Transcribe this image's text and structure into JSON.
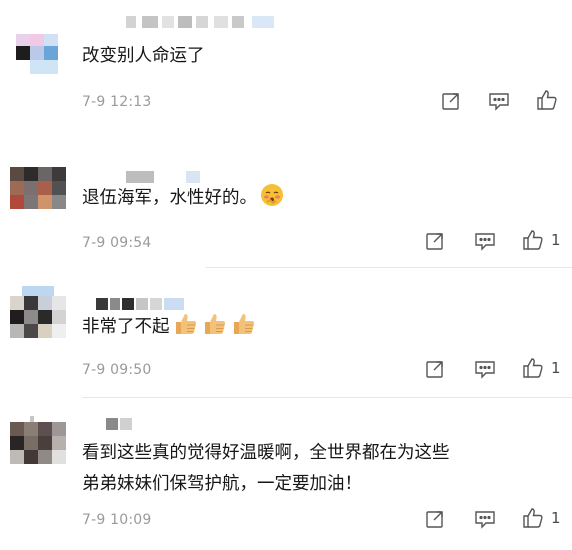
{
  "comments": [
    {
      "text": "改变别人命运了",
      "timestamp": "7-9 12:13",
      "likes": ""
    },
    {
      "text": "退伍海军，水性好的。",
      "timestamp": "7-9 09:54",
      "likes": "1"
    },
    {
      "text": "非常了不起",
      "timestamp": "7-9 09:50",
      "likes": "1"
    },
    {
      "text_line1": "看到这些真的觉得好温暖啊，全世界都在为这些",
      "text_line2": "弟弟妹妹们保驾护航，一定要加油！",
      "timestamp": "7-9 10:09",
      "likes": "1"
    }
  ],
  "icons": {
    "share": "share-icon",
    "comment": "comment-icon",
    "like": "thumbs-up-icon",
    "emoji_blush": "blushing-face-emoji",
    "emoji_thumb": "thumbs-up-emoji"
  },
  "colors": {
    "timestamp": "#9a9a9a",
    "divider": "#e6e6e6",
    "icon": "#555555"
  }
}
